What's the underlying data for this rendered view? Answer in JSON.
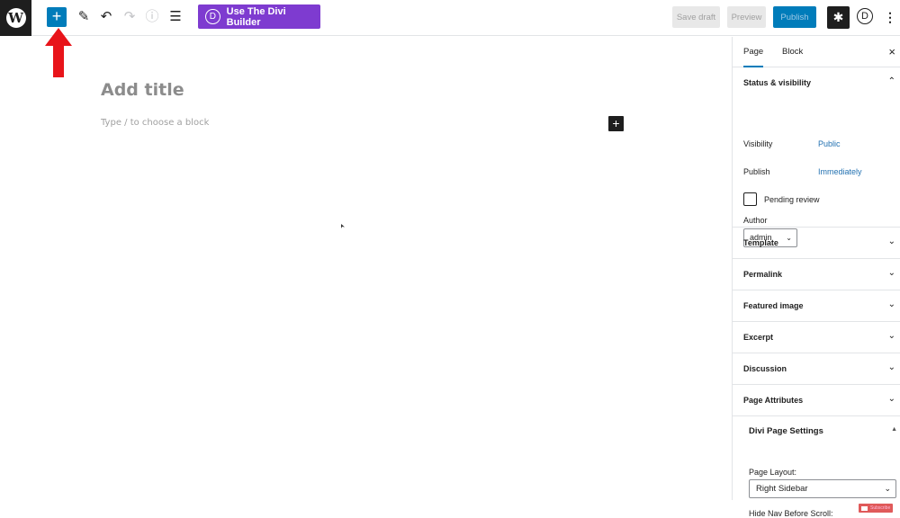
{
  "toolbar": {
    "logo_glyph": "W",
    "add_block_glyph": "+",
    "tools": [
      {
        "name": "edit-tool-icon",
        "glyph": "✎"
      },
      {
        "name": "undo-icon",
        "glyph": "↶"
      },
      {
        "name": "redo-icon",
        "glyph": "↷"
      },
      {
        "name": "info-icon",
        "glyph": "ⓘ"
      },
      {
        "name": "list-view-icon",
        "glyph": "☰"
      }
    ],
    "divi_button_label": "Use The Divi Builder",
    "divi_letter": "D",
    "save_draft_label": "Save draft",
    "preview_label": "Preview",
    "publish_label": "Publish",
    "settings_glyph": "✱",
    "divi_icon_letter": "D",
    "more_glyph": "⋮"
  },
  "editor": {
    "title_placeholder": "Add title",
    "block_placeholder": "Type / to choose a block",
    "inline_add_glyph": "+"
  },
  "sidebar": {
    "tabs": [
      "Page",
      "Block"
    ],
    "close_glyph": "×",
    "status_panel": {
      "title": "Status & visibility",
      "visibility_label": "Visibility",
      "visibility_value": "Public",
      "publish_label": "Publish",
      "publish_value": "Immediately",
      "pending_review_label": "Pending review",
      "pending_review_checked": false,
      "author_label": "Author",
      "author_value": "admin"
    },
    "panels": [
      "Template",
      "Permalink",
      "Featured image",
      "Excerpt",
      "Discussion",
      "Page Attributes"
    ],
    "divi_settings": {
      "title": "Divi Page Settings",
      "page_layout_label": "Page Layout:",
      "page_layout_value": "Right Sidebar",
      "hide_nav_label": "Hide Nav Before Scroll:",
      "subscribe_label": "Subscribe"
    },
    "chevron_down": "⌄",
    "chevron_up": "⌃"
  },
  "colors": {
    "accent": "#007cba",
    "divi_purple": "#7e3bd0",
    "link": "#2271b1",
    "arrow": "#e8141a"
  }
}
